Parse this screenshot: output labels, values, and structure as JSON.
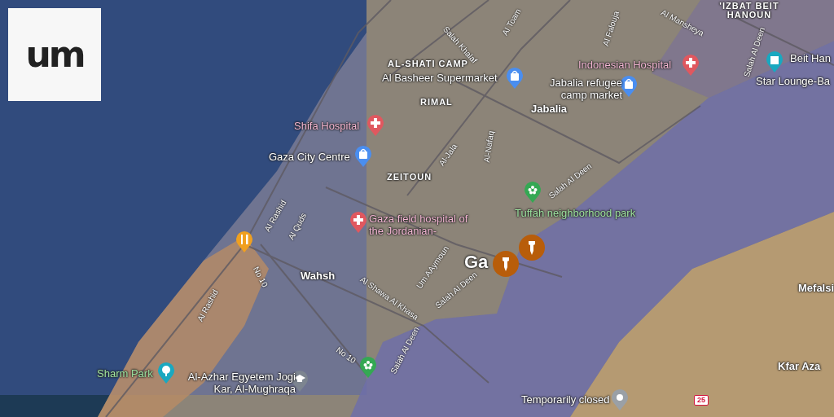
{
  "logo": {
    "text": "um"
  },
  "places": [
    {
      "kind": "hospital",
      "label": "Indonesian Hospital"
    },
    {
      "kind": "shop",
      "label": "Al Basheer Supermarket"
    },
    {
      "kind": "shop",
      "label": "Jabalia refugee camp market"
    },
    {
      "kind": "tourist",
      "label": "Beit Han"
    },
    {
      "kind": "none",
      "label": "Star Lounge-Ba"
    },
    {
      "kind": "hospital",
      "label": "Shifa Hospital"
    },
    {
      "kind": "shop",
      "label": "Gaza City Centre"
    },
    {
      "kind": "hospital",
      "label": "Gaza field hospital of the Jordanian-"
    },
    {
      "kind": "park",
      "label": "Tuffah neighborhood park"
    },
    {
      "kind": "restaurant"
    },
    {
      "kind": "tree",
      "label": "Sharm Park"
    },
    {
      "kind": "school",
      "label": "Al-Azhar Egyetem Jogi Kar, Al-Mughraqa"
    },
    {
      "kind": "park"
    },
    {
      "kind": "closed",
      "label": "Temporarily closed"
    }
  ],
  "areas": [
    {
      "kind": "district",
      "label": "AL-SHATI CAMP"
    },
    {
      "kind": "district",
      "label": "RIMAL"
    },
    {
      "kind": "district",
      "label": "ZEITOUN"
    },
    {
      "kind": "district",
      "label": "'IZBAT BEIT HANOUN"
    },
    {
      "kind": "town",
      "label": "Jabalia"
    },
    {
      "kind": "town",
      "label": "Wahsh"
    },
    {
      "kind": "city",
      "label": "Ga"
    },
    {
      "kind": "town",
      "label": "Mefalsi"
    },
    {
      "kind": "town",
      "label": "Kfar Aza"
    }
  ],
  "roads": [
    "Salah Khalaf",
    "Al Toam",
    "Al Falouja",
    "Al Mansheya",
    "Salah Al Deen",
    "Al-Jala",
    "Al-Nafaq",
    "Salah Al Deen",
    "Al Rashid",
    "Al Quds",
    "No 10",
    "Al Rashid",
    "Al Shawa Al Khasa",
    "Um AAymoun",
    "Salah Al Deen",
    "Salah Al Deen",
    "No 10"
  ],
  "markers": [
    {
      "kind": "bomb"
    },
    {
      "kind": "bomb"
    }
  ],
  "route_shield": "25"
}
